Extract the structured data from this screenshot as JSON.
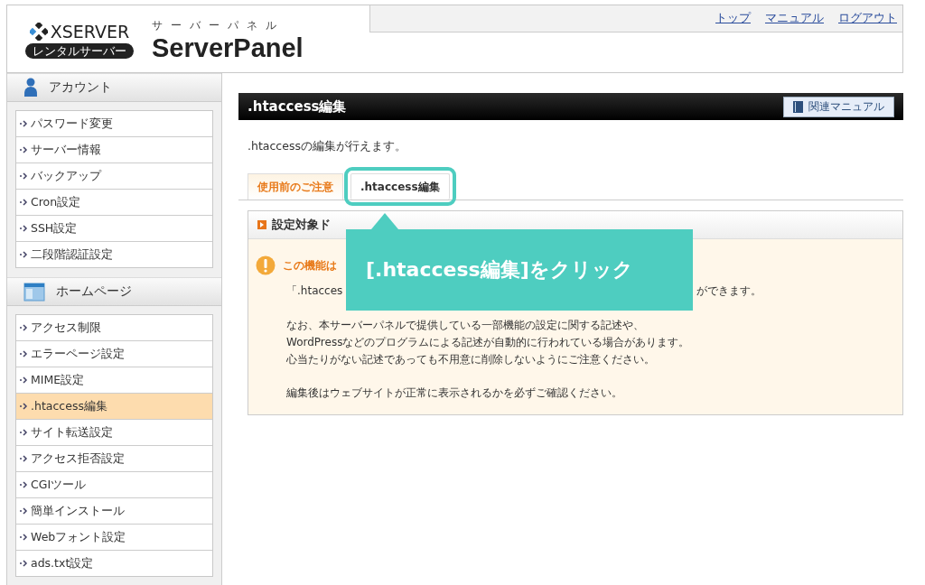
{
  "header": {
    "logo": "XSERVER",
    "logo_badge": "レンタルサーバー",
    "subtitle": "サーバーパネル",
    "title": "ServerPanel",
    "links": [
      "トップ",
      "マニュアル",
      "ログアウト"
    ]
  },
  "sidebar": [
    {
      "kind": "account",
      "title": "アカウント",
      "items": [
        {
          "label": "パスワード変更",
          "selected": false
        },
        {
          "label": "サーバー情報",
          "selected": false
        },
        {
          "label": "バックアップ",
          "selected": false
        },
        {
          "label": "Cron設定",
          "selected": false
        },
        {
          "label": "SSH設定",
          "selected": false
        },
        {
          "label": "二段階認証設定",
          "selected": false
        }
      ]
    },
    {
      "kind": "homepage",
      "title": "ホームページ",
      "items": [
        {
          "label": "アクセス制限",
          "selected": false
        },
        {
          "label": "エラーページ設定",
          "selected": false
        },
        {
          "label": "MIME設定",
          "selected": false
        },
        {
          "label": ".htaccess編集",
          "selected": true
        },
        {
          "label": "サイト転送設定",
          "selected": false
        },
        {
          "label": "アクセス拒否設定",
          "selected": false
        },
        {
          "label": "CGIツール",
          "selected": false
        },
        {
          "label": "簡単インストール",
          "selected": false
        },
        {
          "label": "Webフォント設定",
          "selected": false
        },
        {
          "label": "ads.txt設定",
          "selected": false
        }
      ]
    }
  ],
  "content": {
    "title": ".htaccess編集",
    "manual_button": "関連マニュアル",
    "description": ".htaccessの編集が行えます。",
    "tabs": [
      {
        "label": "使用前のご注意",
        "selected": true,
        "highlighted": false
      },
      {
        "label": ".htaccess編集",
        "selected": false,
        "highlighted": true
      }
    ],
    "panel_heading": "設定対象ド",
    "notice": {
      "heading": "この機能は",
      "lead_visible": [
        "「.htacces",
        "ができます。"
      ],
      "paragraphs": [
        [
          "なお、本サーバーパネルで提供している一部機能の設定に関する記述や、",
          "WordPressなどのプログラムによる記述が自動的に行われている場合があります。",
          "心当たりがない記述であっても不用意に削除しないようにご注意ください。"
        ],
        [
          "編集後はウェブサイトが正常に表示されるかを必ずご確認ください。"
        ]
      ]
    }
  },
  "callout": {
    "text": "[.htaccess編集]をクリック"
  }
}
